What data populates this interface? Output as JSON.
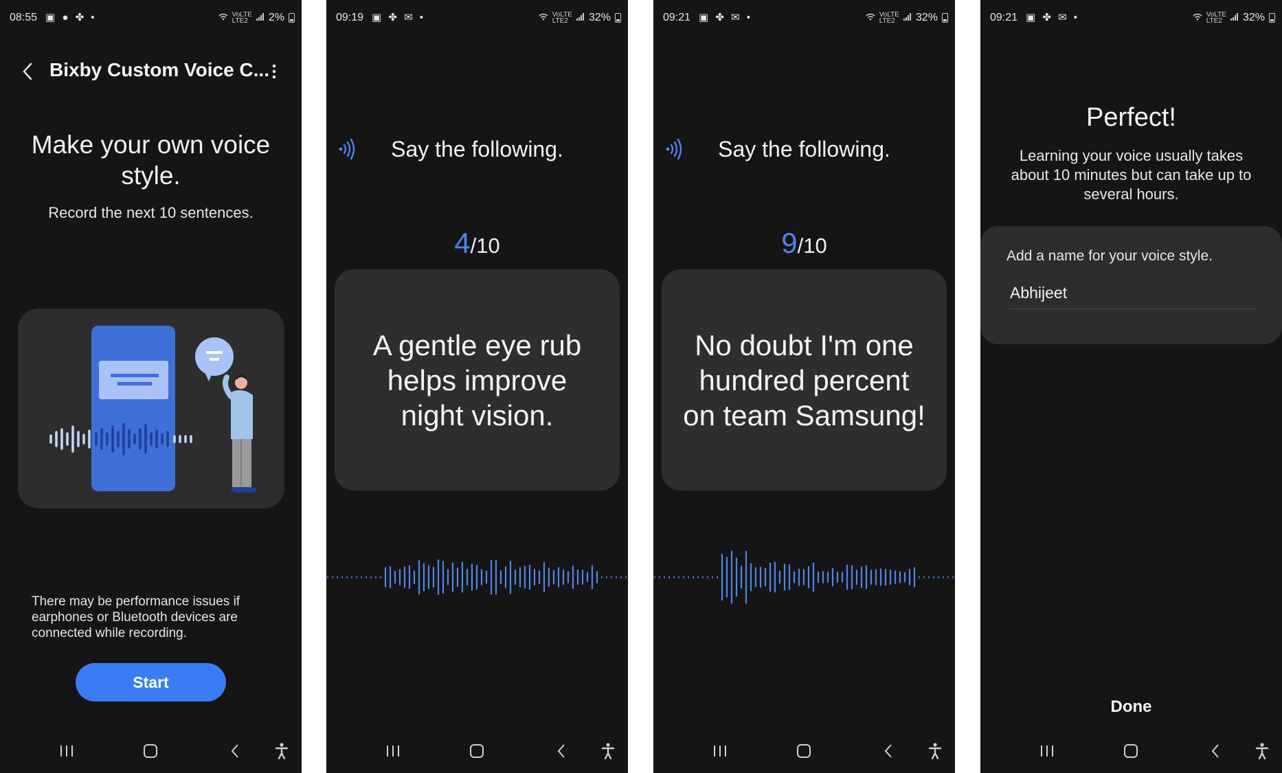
{
  "screens": [
    {
      "status": {
        "time": "08:55",
        "battery": "2%",
        "network": [
          "VoLTE",
          "LTE2"
        ]
      },
      "title": "Bixby Custom Voice C...",
      "heading": "Make your own voice style.",
      "subheading": "Record the next 10 sentences.",
      "warning": "There may be performance issues if earphones or Bluetooth devices are connected while recording.",
      "start_label": "Start"
    },
    {
      "status": {
        "time": "09:19",
        "battery": "32%",
        "network": [
          "VoLTE",
          "LTE2"
        ]
      },
      "instruction": "Say the following.",
      "counter_current": "4",
      "counter_total": "/10",
      "sentence": "A gentle eye rub helps improve night vision."
    },
    {
      "status": {
        "time": "09:21",
        "battery": "32%",
        "network": [
          "VoLTE",
          "LTE2"
        ]
      },
      "instruction": "Say the following.",
      "counter_current": "9",
      "counter_total": "/10",
      "sentence": "No doubt I'm one hundred percent on team Samsung!"
    },
    {
      "status": {
        "time": "09:21",
        "battery": "32%",
        "network": [
          "VoLTE",
          "LTE2"
        ]
      },
      "title": "Perfect!",
      "message": "Learning your voice usually takes about 10 minutes but can take up to several hours.",
      "name_label": "Add a name for your voice style.",
      "name_value": "Abhijeet",
      "done_label": "Done"
    }
  ],
  "colors": {
    "background": "#151515",
    "card": "#2d2d2d",
    "accent": "#3a7cf5",
    "counter": "#4d84f0",
    "waveform": "#4f86e6"
  },
  "icons": [
    "back-icon",
    "more-options-icon",
    "recording-icon",
    "recent-apps-icon",
    "home-icon",
    "nav-back-icon",
    "accessibility-icon"
  ]
}
